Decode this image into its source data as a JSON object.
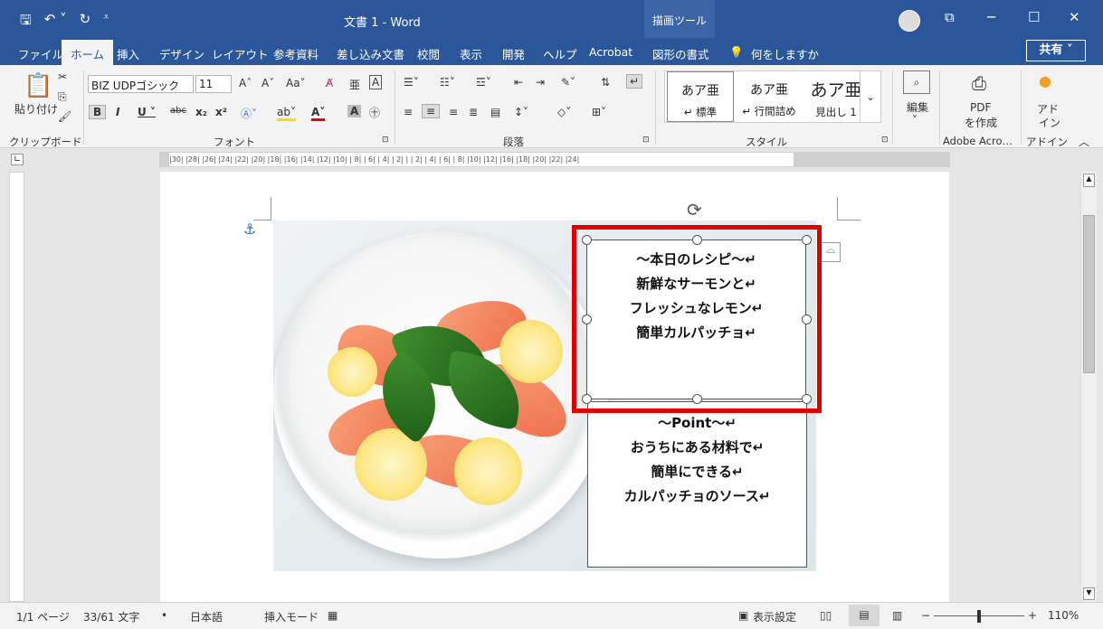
{
  "titlebar": {
    "title": "文書 1  -  Word",
    "drawing_tools": "描画ツール",
    "minimize": "─",
    "restore": "☐",
    "close": "✕"
  },
  "tabs": [
    "ファイル",
    "ホーム",
    "挿入",
    "デザイン",
    "レイアウト",
    "参考資料",
    "差し込み文書",
    "校閲",
    "表示",
    "開発",
    "ヘルプ",
    "Acrobat",
    "図形の書式"
  ],
  "tell_me": "何をしますか",
  "share": "共有",
  "ribbon": {
    "clipboard": {
      "paste": "貼り付け",
      "label": "クリップボード"
    },
    "font": {
      "name": "BIZ UDPゴシック",
      "size": "11",
      "label": "フォント"
    },
    "paragraph": {
      "label": "段落"
    },
    "styles": {
      "items": [
        {
          "preview": "あア亜",
          "name": "↵ 標準"
        },
        {
          "preview": "あア亜",
          "name": "↵ 行間詰め"
        },
        {
          "preview": "あア亜",
          "name": "見出し 1"
        }
      ],
      "label": "スタイル"
    },
    "editing": {
      "label": "編集"
    },
    "pdf": {
      "line1": "PDF",
      "line2": "を作成",
      "label": "Adobe Acro…"
    },
    "addin": {
      "line1": "アド",
      "line2": "イン",
      "label": "アドイン"
    }
  },
  "ruler": {
    "marks": "|30| |28| |26| |24| |22| |20| |18| |16| |14| |12| |10| | 8| | 6| | 4| | 2| |  | 2| | 4| | 6| | 8| |10| |12|    |16| |18| |20| |22| |24|"
  },
  "document": {
    "recipe_box": [
      "～本日のレシピ～↵",
      "新鮮なサーモンと↵",
      "フレッシュなレモン↵",
      "簡単カルパッチョ↵"
    ],
    "point_box": [
      "～Point～↵",
      "おうちにある材料で↵",
      "簡単にできる↵",
      "カルパッチョのソース↵"
    ]
  },
  "statusbar": {
    "page": "1/1 ページ",
    "words": "33/61 文字",
    "language": "日本語",
    "mode": "挿入モード",
    "display_settings": "表示設定",
    "zoom": "110%"
  }
}
